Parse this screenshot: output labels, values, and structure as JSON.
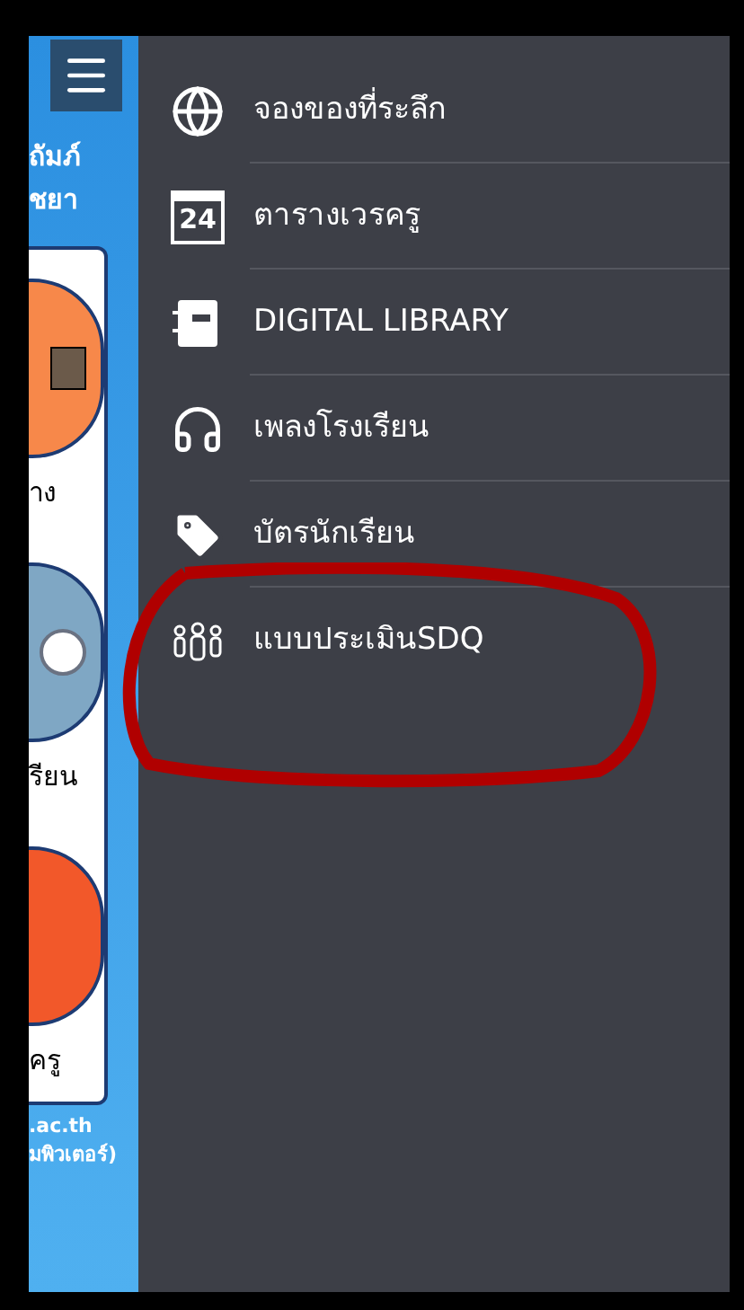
{
  "background_app": {
    "header_lines": [
      "ถัมภ์",
      "ชยา"
    ],
    "tiles": [
      {
        "label": "าง",
        "kind": "box",
        "color": "#f7884a"
      },
      {
        "label": "รียน",
        "kind": "clock",
        "color": "#7fa7c4"
      },
      {
        "label": "ครู",
        "kind": "plain",
        "color": "#f2582a"
      }
    ],
    "footer_lines": [
      ".ac.th",
      "มพิวเตอร์)"
    ]
  },
  "drawer": {
    "items": [
      {
        "label": "จองของที่ระลึก",
        "kind": "globe",
        "highlighted": false
      },
      {
        "label": "ตารางเวรครู",
        "kind": "calendar",
        "icon_text": "24",
        "highlighted": false
      },
      {
        "label": "DIGITAL LIBRARY",
        "kind": "notebook",
        "highlighted": false
      },
      {
        "label": "เพลงโรงเรียน",
        "kind": "headphones",
        "highlighted": false
      },
      {
        "label": "บัตรนักเรียน",
        "kind": "tag",
        "highlighted": false
      },
      {
        "label": "แบบประเมินSDQ",
        "kind": "people",
        "highlighted": true
      }
    ]
  }
}
